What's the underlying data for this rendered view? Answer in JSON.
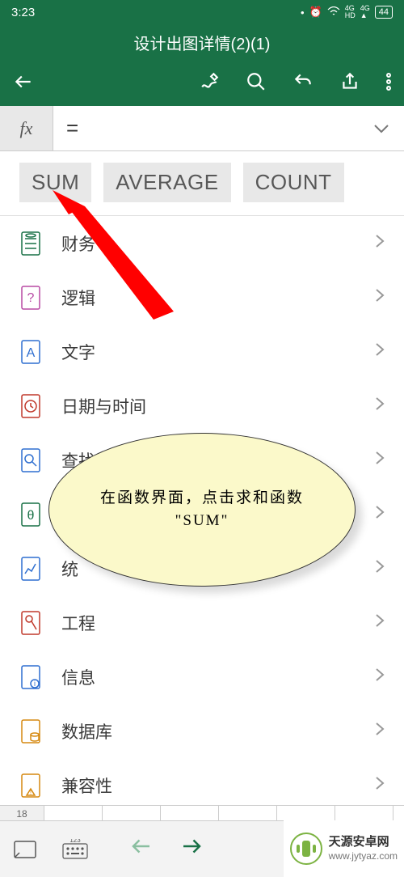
{
  "status": {
    "time": "3:23",
    "battery": "44"
  },
  "title": "设计出图详情(2)(1)",
  "formula": {
    "fx": "fx",
    "value": "="
  },
  "chips": {
    "sum": "SUM",
    "average": "AVERAGE",
    "count": "COUNT"
  },
  "categories": [
    {
      "label": "财务"
    },
    {
      "label": "逻辑"
    },
    {
      "label": "文字"
    },
    {
      "label": "日期与时间"
    },
    {
      "label": "查找"
    },
    {
      "label": ""
    },
    {
      "label": "统"
    },
    {
      "label": "工程"
    },
    {
      "label": "信息"
    },
    {
      "label": "数据库"
    },
    {
      "label": "兼容性"
    }
  ],
  "row18": "18",
  "callout": "在函数界面，点击求和函数 \"SUM\"",
  "watermark": {
    "line1": "天源安卓网",
    "line2": "www.jytyaz.com"
  }
}
